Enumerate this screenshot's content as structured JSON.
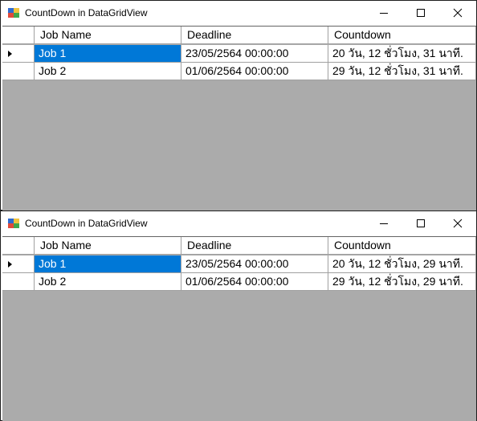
{
  "windows": [
    {
      "title": "CountDown in DataGridView",
      "columns": [
        "Job Name",
        "Deadline",
        "Countdown"
      ],
      "rows": [
        {
          "job": "Job 1",
          "deadline": "23/05/2564 00:00:00",
          "countdown": "20 วัน, 12 ชั่วโมง, 31 นาที."
        },
        {
          "job": "Job 2",
          "deadline": "01/06/2564 00:00:00",
          "countdown": "29 วัน, 12 ชั่วโมง, 31 นาที."
        }
      ]
    },
    {
      "title": "CountDown in DataGridView",
      "columns": [
        "Job Name",
        "Deadline",
        "Countdown"
      ],
      "rows": [
        {
          "job": "Job 1",
          "deadline": "23/05/2564 00:00:00",
          "countdown": "20 วัน, 12 ชั่วโมง, 29 นาที."
        },
        {
          "job": "Job 2",
          "deadline": "01/06/2564 00:00:00",
          "countdown": "29 วัน, 12 ชั่วโมง, 29 นาที."
        }
      ]
    }
  ],
  "colors": {
    "selection": "#0078d7",
    "grid_background": "#ababab"
  },
  "icons": [
    "app-icon",
    "minimize-icon",
    "maximize-icon",
    "close-icon",
    "row-pointer-icon"
  ]
}
